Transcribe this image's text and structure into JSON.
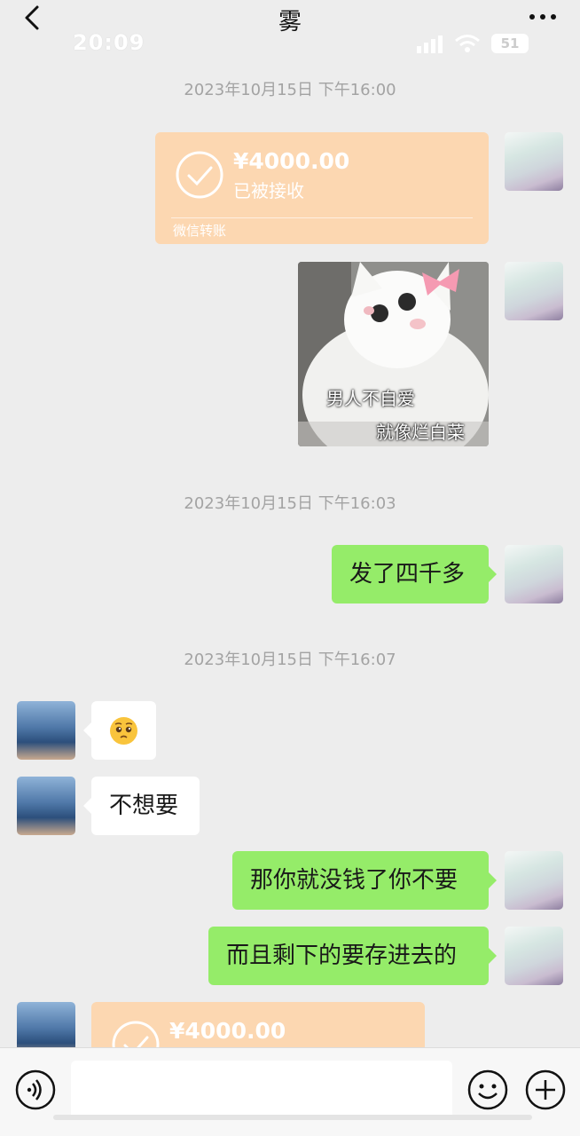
{
  "header": {
    "title": "雾",
    "back_icon": "chevron-left-icon",
    "more_icon": "more-dots-icon"
  },
  "status_bar": {
    "time": "20:09",
    "battery": "51"
  },
  "messages": {
    "ts1": "2023年10月15日 下午16:00",
    "transfer1": {
      "amount": "¥4000.00",
      "status": "已被接收",
      "source": "微信转账"
    },
    "sticker_line1": "男人不自爱",
    "sticker_line2": "就像烂白菜",
    "ts2": "2023年10月15日 下午16:03",
    "msg_sent1": "发了四千多",
    "ts3": "2023年10月15日 下午16:07",
    "msg_recv_emoji": "🥺",
    "msg_recv2": "不想要",
    "msg_sent2": "那你就没钱了你不要",
    "msg_sent3": "而且剩下的要存进去的",
    "transfer2": {
      "amount": "¥4000.00"
    }
  },
  "input": {
    "placeholder": "",
    "voice_icon": "voice-icon",
    "emoji_icon": "emoji-icon",
    "plus_icon": "plus-icon"
  },
  "colors": {
    "background": "#ededed",
    "sent_bubble": "#95ec69",
    "received_bubble": "#ffffff",
    "transfer_card": "#fcd7b1"
  }
}
